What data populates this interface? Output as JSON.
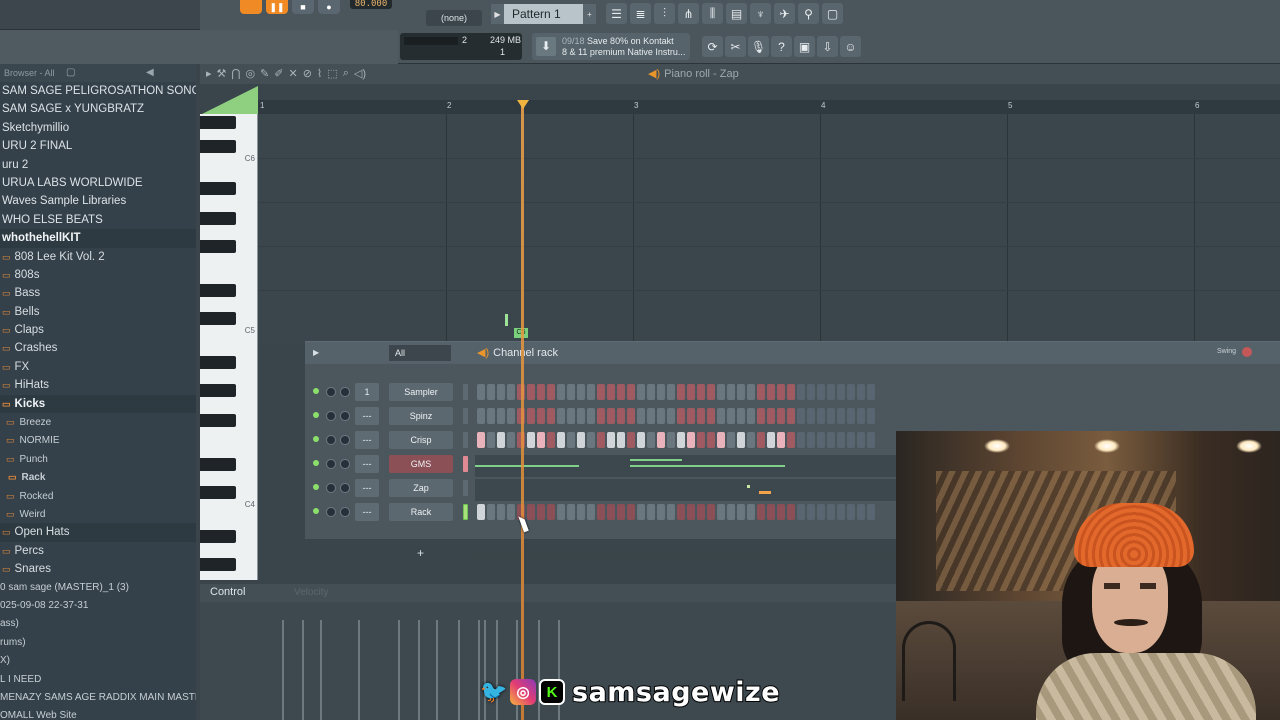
{
  "toolbar": {
    "tempo": "80.000",
    "pattern_selector": "(none)",
    "pattern_label": "Pattern 1",
    "cpu_value": "2",
    "memory": "249 MB",
    "poly": "1",
    "news_count": "09/18",
    "news_line1": "Save 80% on Kontakt",
    "news_line2": "8 & 11 premium Native Instru..."
  },
  "browser": {
    "header": "Browser - All",
    "items": [
      {
        "label": "SAM SAGE PELIGROSATHON SONGS"
      },
      {
        "label": "SAM SAGE x YUNGBRATZ"
      },
      {
        "label": "Sketchymillio"
      },
      {
        "label": "URU 2 FINAL"
      },
      {
        "label": "uru 2"
      },
      {
        "label": "URUA LABS WORLDWIDE"
      },
      {
        "label": "Waves Sample Libraries"
      },
      {
        "label": "WHO ELSE BEATS"
      },
      {
        "label": "whothehellKIT"
      },
      {
        "label": "808 Lee Kit Vol. 2"
      },
      {
        "label": "808s"
      },
      {
        "label": "Bass"
      },
      {
        "label": "Bells"
      },
      {
        "label": "Claps"
      },
      {
        "label": "Crashes"
      },
      {
        "label": "FX"
      },
      {
        "label": "HiHats"
      },
      {
        "label": "Kicks"
      },
      {
        "label": "Breeze"
      },
      {
        "label": "NORMIE"
      },
      {
        "label": "Punch"
      },
      {
        "label": "Rack"
      },
      {
        "label": "Rocked"
      },
      {
        "label": "Weird"
      },
      {
        "label": "Open Hats"
      },
      {
        "label": "Percs"
      },
      {
        "label": "Snares"
      }
    ],
    "files": [
      {
        "label": "0  sam sage (MASTER)_1 (3)"
      },
      {
        "label": "025-09-08 22-37-31"
      },
      {
        "label": "ass)"
      },
      {
        "label": "rums)"
      },
      {
        "label": "X)"
      },
      {
        "label": "L I NEED"
      },
      {
        "label": "MENAZY SAMS AGE RADDIX MAIN MASTER"
      },
      {
        "label": "OMALL Web Site"
      }
    ]
  },
  "piano_roll": {
    "title": "Piano roll - Zap",
    "bars": [
      "1",
      "2",
      "3",
      "4",
      "5",
      "6"
    ],
    "key_labels": [
      "C6",
      "C5",
      "C4"
    ],
    "note_label": "C5"
  },
  "channel_rack": {
    "filter": "All",
    "title": "Channel rack",
    "swing_label": "Swing",
    "add_label": "+",
    "channels": [
      {
        "num": "1",
        "name": "Sampler"
      },
      {
        "num": "---",
        "name": "Spinz"
      },
      {
        "num": "---",
        "name": "Crisp"
      },
      {
        "num": "---",
        "name": "GMS"
      },
      {
        "num": "---",
        "name": "Zap"
      },
      {
        "num": "---",
        "name": "Rack"
      }
    ]
  },
  "control": {
    "label": "Control",
    "sublabel": "Velocity"
  },
  "overlay": {
    "handle": "samsagewize"
  },
  "colors": {
    "accent_orange": "#f08a24",
    "playhead": "#f3a34a",
    "led_green": "#8be06a"
  }
}
